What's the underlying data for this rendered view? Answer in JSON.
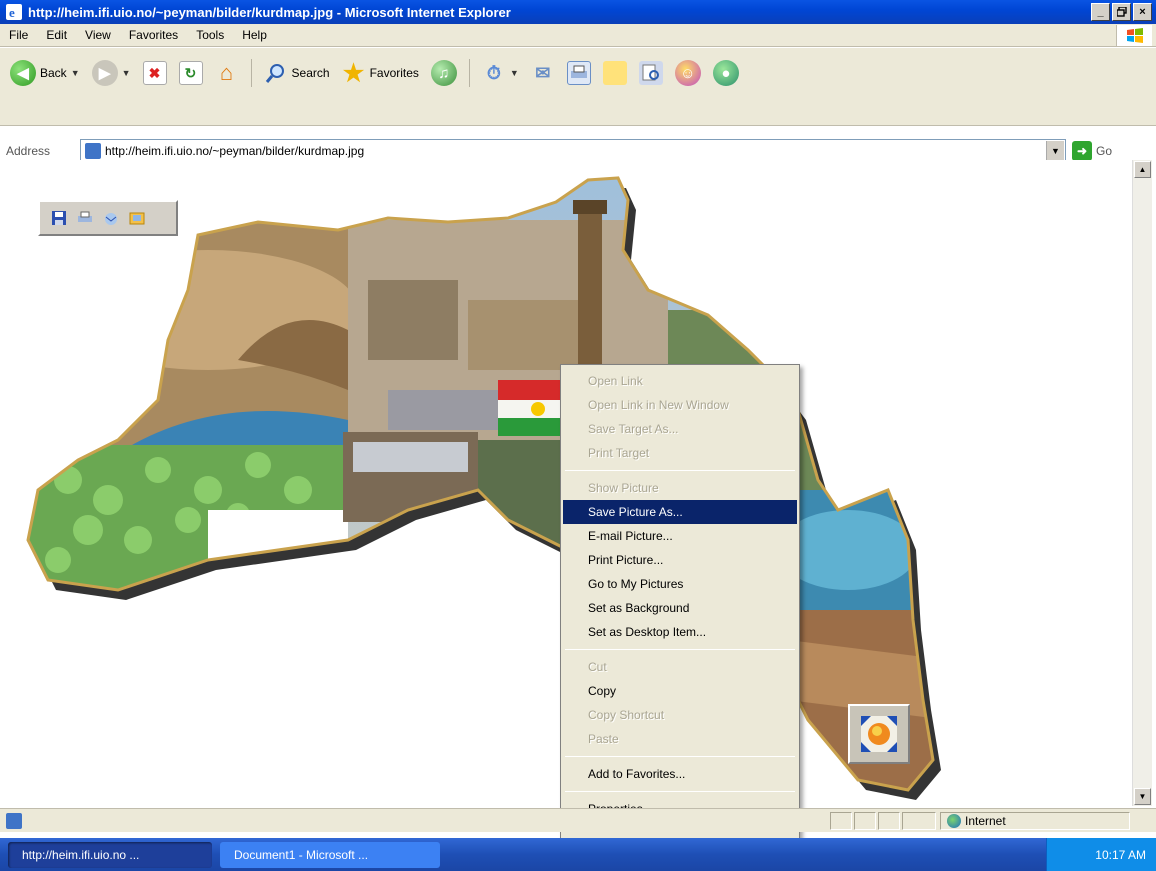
{
  "window": {
    "title": "http://heim.ifi.uio.no/~peyman/bilder/kurdmap.jpg - Microsoft Internet Explorer",
    "buttons": [
      "_",
      "×"
    ]
  },
  "menubar": {
    "items": [
      "File",
      "Edit",
      "View",
      "Favorites",
      "Tools",
      "Help"
    ]
  },
  "toolbar": {
    "back_label": "Back",
    "search_label": "Search",
    "favorites_label": "Favorites"
  },
  "address": {
    "label": "Address",
    "value": "http://heim.ifi.uio.no/~peyman/bilder/kurdmap.jpg",
    "go_label": "Go"
  },
  "context_menu": {
    "items": [
      {
        "label": "Open Link",
        "enabled": false
      },
      {
        "label": "Open Link in New Window",
        "enabled": false
      },
      {
        "label": "Save Target As...",
        "enabled": false
      },
      {
        "label": "Print Target",
        "enabled": false
      },
      {
        "separator": true
      },
      {
        "label": "Show Picture",
        "enabled": false
      },
      {
        "label": "Save Picture As...",
        "enabled": true,
        "selected": true
      },
      {
        "label": "E-mail Picture...",
        "enabled": true
      },
      {
        "label": "Print Picture...",
        "enabled": true
      },
      {
        "label": "Go to My Pictures",
        "enabled": true
      },
      {
        "label": "Set as Background",
        "enabled": true
      },
      {
        "label": "Set as Desktop Item...",
        "enabled": true
      },
      {
        "separator": true
      },
      {
        "label": "Cut",
        "enabled": false
      },
      {
        "label": "Copy",
        "enabled": true
      },
      {
        "label": "Copy Shortcut",
        "enabled": false
      },
      {
        "label": "Paste",
        "enabled": false
      },
      {
        "separator": true
      },
      {
        "label": "Add to Favorites...",
        "enabled": true
      },
      {
        "separator": true
      },
      {
        "label": "Properties",
        "enabled": true
      }
    ]
  },
  "statusbar": {
    "zone": "Internet"
  },
  "taskbar": {
    "tasks": [
      "http://heim.ifi.uio.no ...",
      "Document1 - Microsoft ..."
    ],
    "clock": "10:17 AM"
  }
}
